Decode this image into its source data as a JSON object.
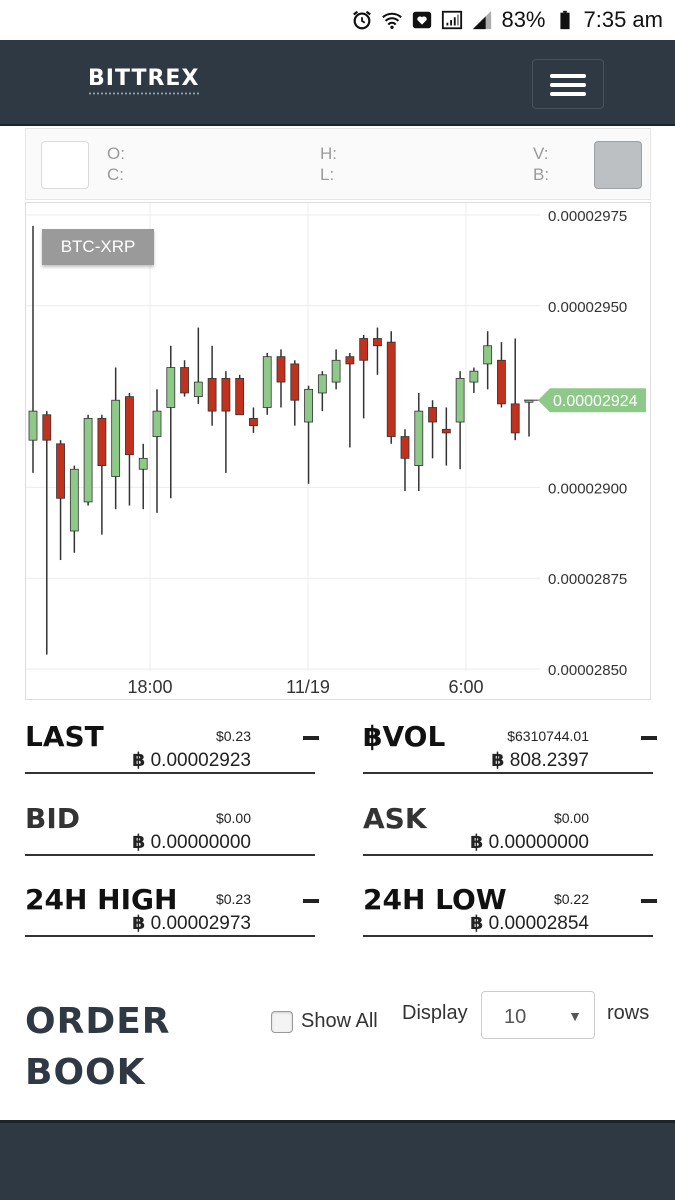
{
  "status_bar": {
    "battery": "83%",
    "time": "7:35 am",
    "icons": [
      "alarm-icon",
      "wifi-icon",
      "heart-message-icon",
      "signal-icon",
      "battery-icon"
    ]
  },
  "header": {
    "logo": "BITTREX",
    "menu_icon": "hamburger-icon",
    "background": "#2f3944"
  },
  "ohlc": {
    "open_label": "O:",
    "close_label": "C:",
    "high_label": "H:",
    "low_label": "L:",
    "volume_label": "V:",
    "base_label": "B:"
  },
  "chart_data": {
    "type": "candlestick",
    "pair_label": "BTC-XRP",
    "y_ticks": [
      "0.00002975",
      "0.00002950",
      "0.00002900",
      "0.00002875",
      "0.00002850"
    ],
    "x_ticks": [
      "18:00",
      "11/19",
      "6:00"
    ],
    "ylim": [
      2.85e-05,
      2.975e-05
    ],
    "current_price": "0.00002924",
    "up_color": "#8fc98a",
    "down_color": "#c0321e",
    "price_tag_color": "#8fc98a",
    "candles": [
      {
        "o": 2.913e-05,
        "c": 2.921e-05,
        "h": 2.972e-05,
        "l": 2.904e-05
      },
      {
        "o": 2.92e-05,
        "c": 2.913e-05,
        "h": 2.921e-05,
        "l": 2.854e-05
      },
      {
        "o": 2.912e-05,
        "c": 2.897e-05,
        "h": 2.913e-05,
        "l": 2.88e-05
      },
      {
        "o": 2.888e-05,
        "c": 2.905e-05,
        "h": 2.906e-05,
        "l": 2.882e-05
      },
      {
        "o": 2.896e-05,
        "c": 2.919e-05,
        "h": 2.92e-05,
        "l": 2.895e-05
      },
      {
        "o": 2.919e-05,
        "c": 2.906e-05,
        "h": 2.92e-05,
        "l": 2.887e-05
      },
      {
        "o": 2.903e-05,
        "c": 2.924e-05,
        "h": 2.933e-05,
        "l": 2.894e-05
      },
      {
        "o": 2.925e-05,
        "c": 2.909e-05,
        "h": 2.926e-05,
        "l": 2.895e-05
      },
      {
        "o": 2.905e-05,
        "c": 2.908e-05,
        "h": 2.912e-05,
        "l": 2.894e-05
      },
      {
        "o": 2.914e-05,
        "c": 2.921e-05,
        "h": 2.927e-05,
        "l": 2.893e-05
      },
      {
        "o": 2.922e-05,
        "c": 2.933e-05,
        "h": 2.939e-05,
        "l": 2.897e-05
      },
      {
        "o": 2.933e-05,
        "c": 2.926e-05,
        "h": 2.935e-05,
        "l": 2.925e-05
      },
      {
        "o": 2.925e-05,
        "c": 2.929e-05,
        "h": 2.944e-05,
        "l": 2.923e-05
      },
      {
        "o": 2.93e-05,
        "c": 2.921e-05,
        "h": 2.939e-05,
        "l": 2.917e-05
      },
      {
        "o": 2.93e-05,
        "c": 2.921e-05,
        "h": 2.932e-05,
        "l": 2.904e-05
      },
      {
        "o": 2.93e-05,
        "c": 2.92e-05,
        "h": 2.931e-05,
        "l": 2.92e-05
      },
      {
        "o": 2.919e-05,
        "c": 2.917e-05,
        "h": 2.922e-05,
        "l": 2.915e-05
      },
      {
        "o": 2.922e-05,
        "c": 2.936e-05,
        "h": 2.937e-05,
        "l": 2.92e-05
      },
      {
        "o": 2.936e-05,
        "c": 2.929e-05,
        "h": 2.938e-05,
        "l": 2.922e-05
      },
      {
        "o": 2.934e-05,
        "c": 2.924e-05,
        "h": 2.935e-05,
        "l": 2.917e-05
      },
      {
        "o": 2.918e-05,
        "c": 2.927e-05,
        "h": 2.928e-05,
        "l": 2.901e-05
      },
      {
        "o": 2.926e-05,
        "c": 2.931e-05,
        "h": 2.932e-05,
        "l": 2.921e-05
      },
      {
        "o": 2.929e-05,
        "c": 2.935e-05,
        "h": 2.938e-05,
        "l": 2.927e-05
      },
      {
        "o": 2.936e-05,
        "c": 2.934e-05,
        "h": 2.937e-05,
        "l": 2.911e-05
      },
      {
        "o": 2.941e-05,
        "c": 2.935e-05,
        "h": 2.942e-05,
        "l": 2.919e-05
      },
      {
        "o": 2.941e-05,
        "c": 2.939e-05,
        "h": 2.944e-05,
        "l": 2.931e-05
      },
      {
        "o": 2.94e-05,
        "c": 2.914e-05,
        "h": 2.943e-05,
        "l": 2.912e-05
      },
      {
        "o": 2.914e-05,
        "c": 2.908e-05,
        "h": 2.916e-05,
        "l": 2.899e-05
      },
      {
        "o": 2.906e-05,
        "c": 2.921e-05,
        "h": 2.926e-05,
        "l": 2.899e-05
      },
      {
        "o": 2.922e-05,
        "c": 2.918e-05,
        "h": 2.924e-05,
        "l": 2.908e-05
      },
      {
        "o": 2.916e-05,
        "c": 2.915e-05,
        "h": 2.922e-05,
        "l": 2.906e-05
      },
      {
        "o": 2.918e-05,
        "c": 2.93e-05,
        "h": 2.932e-05,
        "l": 2.905e-05
      },
      {
        "o": 2.929e-05,
        "c": 2.932e-05,
        "h": 2.933e-05,
        "l": 2.926e-05
      },
      {
        "o": 2.934e-05,
        "c": 2.939e-05,
        "h": 2.943e-05,
        "l": 2.927e-05
      },
      {
        "o": 2.935e-05,
        "c": 2.923e-05,
        "h": 2.94e-05,
        "l": 2.922e-05
      },
      {
        "o": 2.923e-05,
        "c": 2.915e-05,
        "h": 2.941e-05,
        "l": 2.913e-05
      },
      {
        "o": 2.924e-05,
        "c": 2.924e-05,
        "h": 2.924e-05,
        "l": 2.914e-05
      }
    ]
  },
  "stats": {
    "last": {
      "name": "LAST",
      "usd": "$0.23",
      "btc": "0.00002923"
    },
    "vol": {
      "name": "฿VOL",
      "usd": "$6310744.01",
      "btc": "808.2397"
    },
    "bid": {
      "name": "BID",
      "usd": "$0.00",
      "btc": "0.00000000"
    },
    "ask": {
      "name": "ASK",
      "usd": "$0.00",
      "btc": "0.00000000"
    },
    "high": {
      "name": "24H HIGH",
      "usd": "$0.23",
      "btc": "0.00002973"
    },
    "low": {
      "name": "24H LOW",
      "usd": "$0.22",
      "btc": "0.00002854"
    },
    "btc_symbol": "฿"
  },
  "order_book": {
    "title_line1": "ORDER",
    "title_line2": "BOOK",
    "show_all_label": "Show All",
    "display_label": "Display",
    "rows_value": "10",
    "rows_label": "rows"
  }
}
